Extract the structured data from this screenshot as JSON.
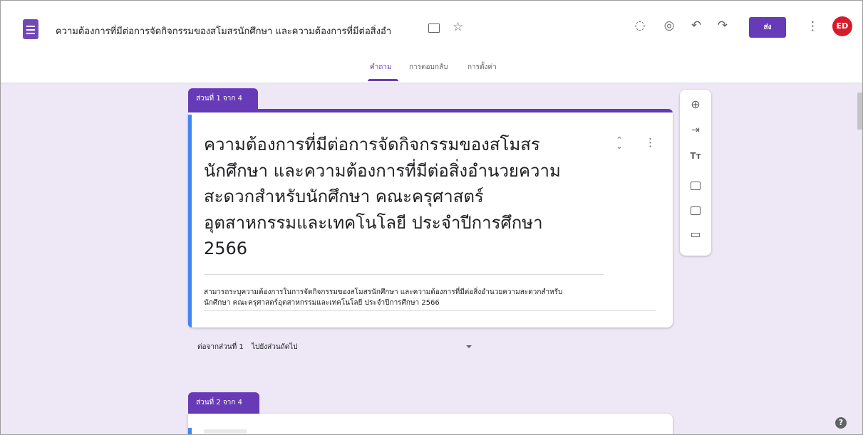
{
  "header": {
    "title": "ความต้องการที่มีต่อการจัดกิจกรรมของสโมสรนักศึกษา และความต้องการที่มีต่อสิ่งอำ",
    "send_label": "ส่ง",
    "avatar_text": "ED",
    "icons": [
      "forms-logo-icon",
      "folder-icon",
      "star-icon",
      "palette-icon",
      "preview-eye-icon",
      "undo-icon",
      "redo-icon",
      "more-vert-icon"
    ]
  },
  "tabs": [
    {
      "label": "คำถาม",
      "active": true
    },
    {
      "label": "การตอบกลับ",
      "active": false
    },
    {
      "label": "การตั้งค่า",
      "active": false
    }
  ],
  "section1": {
    "tab_label": "ส่วนที่ 1 จาก 4",
    "title_lines": [
      "ความต้องการที่มีต่อการจัดกิจกรรมของสโมสร",
      "นักศึกษา และความต้องการที่มีต่อสิ่งอำนวยความ",
      "สะดวกสำหรับนักศึกษา คณะครุศาสตร์",
      "อุตสาหกรรมและเทคโนโลยี ประจำปีการศึกษา",
      "2566"
    ],
    "description_lines": [
      "สามารถระบุความต้องการในการจัดกิจกรรมของสโมสรนักศึกษา และความต้องการที่มีต่อสิ่งอำนวยความสะดวกสำหรับ",
      "นักศึกษา คณะครุศาสตร์อุตสาหกรรมและเทคโนโลยี ประจำปีการศึกษา 2566"
    ]
  },
  "after_section": {
    "label": "ต่อจากส่วนที่ 1",
    "value": "ไปยังส่วนถัดไป"
  },
  "section2": {
    "tab_label": "ส่วนที่ 2 จาก 4"
  },
  "toolbar": {
    "icons": [
      "add-question-icon",
      "import-questions-icon",
      "add-title-icon",
      "add-image-icon",
      "add-video-icon",
      "add-section-icon"
    ],
    "title_glyph": "Tт"
  },
  "colors": {
    "accent": "#673ab7",
    "background": "#ede7f6",
    "focus_edge": "#4285f4",
    "avatar": "#d81b2c"
  }
}
